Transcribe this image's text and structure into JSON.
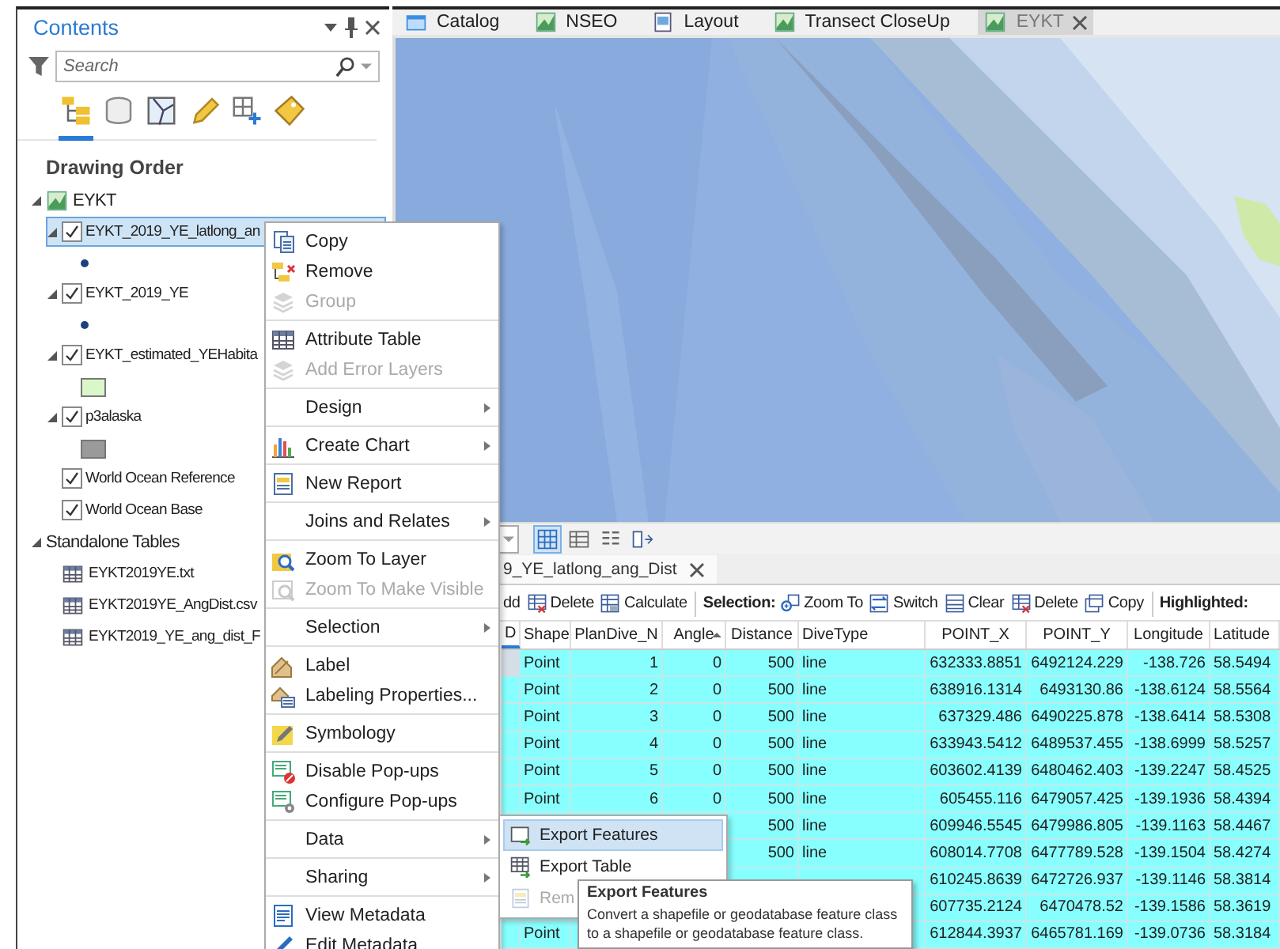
{
  "contents": {
    "title": "Contents",
    "search": {
      "placeholder": "Search"
    },
    "view_tabs": [
      {
        "kind": "drawing_order",
        "selected": true
      },
      {
        "kind": "data_source",
        "selected": false
      },
      {
        "kind": "selection",
        "selected": false
      },
      {
        "kind": "editing",
        "selected": false
      },
      {
        "kind": "snapping",
        "selected": false
      },
      {
        "kind": "labeling",
        "selected": false
      }
    ],
    "heading": "Drawing Order",
    "tree": [
      {
        "kind": "map",
        "label": "EYKT",
        "expanded": true,
        "selected": false,
        "children": [
          {
            "kind": "layer",
            "label": "EYKT_2019_YE_latlong_an",
            "expanded": true,
            "checked": true,
            "selected": true,
            "symbol": {
              "kind": "point",
              "color": "#1f3f7f"
            }
          },
          {
            "kind": "layer",
            "label": "EYKT_2019_YE",
            "expanded": true,
            "checked": true,
            "selected": false,
            "symbol": {
              "kind": "point",
              "color": "#1f3f7f"
            }
          },
          {
            "kind": "layer",
            "label": "EYKT_estimated_YEHabita",
            "expanded": true,
            "checked": true,
            "selected": false,
            "symbol": {
              "kind": "polygon",
              "color": "#d9f7c9"
            }
          },
          {
            "kind": "layer",
            "label": "p3alaska",
            "expanded": true,
            "checked": true,
            "selected": false,
            "symbol": {
              "kind": "polygon",
              "color": "#9a9a9a"
            }
          },
          {
            "kind": "basemap",
            "label": "World Ocean Reference",
            "checked": true,
            "selected": false
          },
          {
            "kind": "basemap",
            "label": "World Ocean Base",
            "checked": true,
            "selected": false
          }
        ]
      },
      {
        "kind": "group",
        "label": "Standalone Tables",
        "expanded": true,
        "selected": false,
        "children": [
          {
            "kind": "table",
            "label": "EYKT2019YE.txt",
            "selected": false
          },
          {
            "kind": "table",
            "label": "EYKT2019YE_AngDist.csv",
            "selected": false
          },
          {
            "kind": "table",
            "label": "EYKT2019_YE_ang_dist_F",
            "selected": false
          }
        ]
      }
    ]
  },
  "map_tabs": [
    {
      "kind": "catalog",
      "label": "Catalog",
      "selected": false
    },
    {
      "kind": "map",
      "label": "NSEO",
      "selected": false
    },
    {
      "kind": "layout",
      "label": "Layout",
      "selected": false
    },
    {
      "kind": "map",
      "label": "Transect CloseUp",
      "selected": false
    },
    {
      "kind": "map",
      "label": "EYKT",
      "selected": true
    }
  ],
  "table_view": {
    "tab": {
      "label": "9_YE_latlong_ang_Dist",
      "selected": true
    },
    "toolbar": [
      {
        "kind": "button",
        "label": "dd"
      },
      {
        "kind": "button",
        "label": "Delete"
      },
      {
        "kind": "button",
        "label": "Calculate"
      },
      {
        "kind": "separator"
      },
      {
        "kind": "label",
        "label": "Selection:"
      },
      {
        "kind": "button",
        "label": "Zoom To"
      },
      {
        "kind": "button",
        "label": "Switch"
      },
      {
        "kind": "button",
        "label": "Clear"
      },
      {
        "kind": "button",
        "label": "Delete"
      },
      {
        "kind": "button",
        "label": "Copy"
      },
      {
        "kind": "separator"
      },
      {
        "kind": "label",
        "label": "Highlighted:"
      }
    ],
    "columns": [
      {
        "label": "D",
        "selected": true,
        "sorted": false
      },
      {
        "label": "Shape",
        "selected": false,
        "sorted": false
      },
      {
        "label": "PlanDive_N",
        "selected": false,
        "sorted": false
      },
      {
        "label": "Angle",
        "selected": false,
        "sorted": true
      },
      {
        "label": "Distance",
        "selected": false,
        "sorted": false
      },
      {
        "label": "DiveType",
        "selected": false,
        "sorted": false
      },
      {
        "label": "POINT_X",
        "selected": false,
        "sorted": false
      },
      {
        "label": "POINT_Y",
        "selected": false,
        "sorted": false
      },
      {
        "label": "Longitude",
        "selected": false,
        "sorted": false
      },
      {
        "label": "Latitude",
        "selected": false,
        "sorted": false
      }
    ],
    "rows": [
      {
        "selected": true,
        "current": true,
        "cells": [
          null,
          "Point",
          "1",
          "0",
          "500",
          "line",
          "632333.8851",
          "6492124.229",
          "-138.726",
          "58.5494"
        ]
      },
      {
        "selected": true,
        "current": false,
        "cells": [
          null,
          "Point",
          "2",
          "0",
          "500",
          "line",
          "638916.1314",
          "6493130.86",
          "-138.6124",
          "58.5564"
        ]
      },
      {
        "selected": true,
        "current": false,
        "cells": [
          null,
          "Point",
          "3",
          "0",
          "500",
          "line",
          "637329.486",
          "6490225.878",
          "-138.6414",
          "58.5308"
        ]
      },
      {
        "selected": true,
        "current": false,
        "cells": [
          null,
          "Point",
          "4",
          "0",
          "500",
          "line",
          "633943.5412",
          "6489537.455",
          "-138.6999",
          "58.5257"
        ]
      },
      {
        "selected": true,
        "current": false,
        "cells": [
          null,
          "Point",
          "5",
          "0",
          "500",
          "line",
          "603602.4139",
          "6480462.403",
          "-139.2247",
          "58.4525"
        ]
      },
      {
        "selected": true,
        "current": false,
        "cells": [
          null,
          "Point",
          "6",
          "0",
          "500",
          "line",
          "605455.116",
          "6479057.425",
          "-139.1936",
          "58.4394"
        ]
      },
      {
        "selected": true,
        "current": false,
        "cells": [
          null,
          null,
          null,
          null,
          "500",
          "line",
          "609946.5545",
          "6479986.805",
          "-139.1163",
          "58.4467"
        ]
      },
      {
        "selected": true,
        "current": false,
        "cells": [
          null,
          null,
          null,
          null,
          "500",
          "line",
          "608014.7708",
          "6477789.528",
          "-139.1504",
          "58.4274"
        ]
      },
      {
        "selected": true,
        "current": false,
        "cells": [
          null,
          null,
          null,
          null,
          null,
          null,
          "610245.8639",
          "6472726.937",
          "-139.1146",
          "58.3814"
        ]
      },
      {
        "selected": true,
        "current": false,
        "cells": [
          null,
          null,
          null,
          null,
          null,
          null,
          "607735.2124",
          "6470478.52",
          "-139.1586",
          "58.3619"
        ]
      },
      {
        "selected": true,
        "current": false,
        "cells": [
          null,
          "Point",
          null,
          null,
          null,
          null,
          "612844.3937",
          "6465781.169",
          "-139.0736",
          "58.3184"
        ]
      }
    ]
  },
  "context_menu": {
    "groups": [
      [
        {
          "label": "Copy",
          "kind": "copy",
          "disabled": false,
          "submenu": false
        },
        {
          "label": "Remove",
          "kind": "remove",
          "disabled": false,
          "submenu": false
        },
        {
          "label": "Group",
          "kind": "layers",
          "disabled": true,
          "submenu": false
        }
      ],
      [
        {
          "label": "Attribute Table",
          "kind": "table",
          "disabled": false,
          "submenu": false
        },
        {
          "label": "Add Error Layers",
          "kind": "layers",
          "disabled": true,
          "submenu": false
        }
      ],
      [
        {
          "label": "Design",
          "kind": "plain",
          "disabled": false,
          "submenu": true
        }
      ],
      [
        {
          "label": "Create Chart",
          "kind": "chart",
          "disabled": false,
          "submenu": true
        }
      ],
      [
        {
          "label": "New Report",
          "kind": "report",
          "disabled": false,
          "submenu": false
        }
      ],
      [
        {
          "label": "Joins and Relates",
          "kind": "plain",
          "disabled": false,
          "submenu": true
        }
      ],
      [
        {
          "label": "Zoom To Layer",
          "kind": "zoom_layer",
          "disabled": false,
          "submenu": false
        },
        {
          "label": "Zoom To Make Visible",
          "kind": "zoom_visible",
          "disabled": true,
          "submenu": false
        }
      ],
      [
        {
          "label": "Selection",
          "kind": "plain",
          "disabled": false,
          "submenu": true
        }
      ],
      [
        {
          "label": "Label",
          "kind": "label",
          "disabled": false,
          "submenu": false
        },
        {
          "label": "Labeling Properties...",
          "kind": "label_props",
          "disabled": false,
          "submenu": false
        }
      ],
      [
        {
          "label": "Symbology",
          "kind": "symbology",
          "disabled": false,
          "submenu": false
        }
      ],
      [
        {
          "label": "Disable Pop-ups",
          "kind": "popup_off",
          "disabled": false,
          "submenu": false
        },
        {
          "label": "Configure Pop-ups",
          "kind": "popup_cfg",
          "disabled": false,
          "submenu": false
        }
      ],
      [
        {
          "label": "Data",
          "kind": "plain",
          "disabled": false,
          "submenu": true
        }
      ],
      [
        {
          "label": "Sharing",
          "kind": "plain",
          "disabled": false,
          "submenu": true
        }
      ],
      [
        {
          "label": "View Metadata",
          "kind": "metadata",
          "disabled": false,
          "submenu": false
        },
        {
          "label": "Edit Metadata",
          "kind": "pencil",
          "disabled": false,
          "submenu": false
        }
      ]
    ]
  },
  "submenu": {
    "items": [
      {
        "label": "Export Features",
        "kind": "export_features",
        "highlighted": true,
        "disabled": false
      },
      {
        "label": "Export Table",
        "kind": "export_table",
        "highlighted": false,
        "disabled": false
      },
      {
        "label": "Rem",
        "kind": "report",
        "highlighted": false,
        "disabled": true
      }
    ]
  },
  "tooltip": {
    "title": "Export Features",
    "text": "Convert a shapefile or geodatabase feature class to a shapefile or geodatabase feature class."
  }
}
